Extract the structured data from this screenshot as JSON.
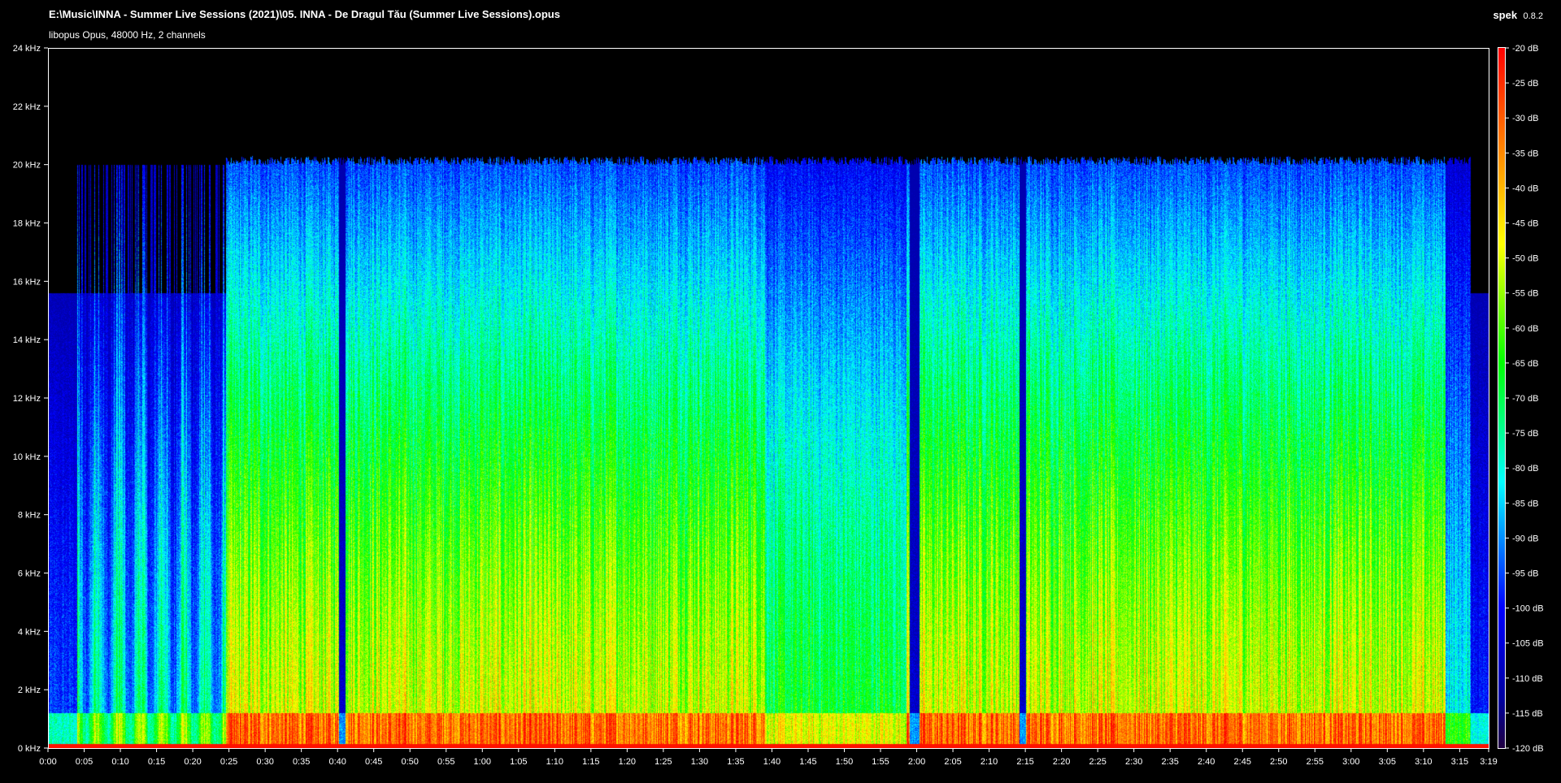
{
  "header": {
    "file_path": "E:\\Music\\INNA - Summer Live Sessions (2021)\\05. INNA - De Dragul Tău (Summer Live Sessions).opus",
    "file_info": "libopus Opus, 48000 Hz, 2 channels",
    "app_name": "spek",
    "app_version": "0.8.2"
  },
  "frequency_axis": {
    "ticks": [
      "0 kHz",
      "2 kHz",
      "4 kHz",
      "6 kHz",
      "8 kHz",
      "10 kHz",
      "12 kHz",
      "14 kHz",
      "16 kHz",
      "18 kHz",
      "20 kHz",
      "22 kHz",
      "24 kHz"
    ]
  },
  "time_axis": {
    "ticks": [
      "0:00",
      "0:05",
      "0:10",
      "0:15",
      "0:20",
      "0:25",
      "0:30",
      "0:35",
      "0:40",
      "0:45",
      "0:50",
      "0:55",
      "1:00",
      "1:05",
      "1:10",
      "1:15",
      "1:20",
      "1:25",
      "1:30",
      "1:35",
      "1:40",
      "1:45",
      "1:50",
      "1:55",
      "2:00",
      "2:05",
      "2:10",
      "2:15",
      "2:20",
      "2:25",
      "2:30",
      "2:35",
      "2:40",
      "2:45",
      "2:50",
      "2:55",
      "3:00",
      "3:05",
      "3:10",
      "3:15",
      "3:19"
    ]
  },
  "db_scale": {
    "ticks": [
      "-20 dB",
      "-25 dB",
      "-30 dB",
      "-35 dB",
      "-40 dB",
      "-45 dB",
      "-50 dB",
      "-55 dB",
      "-60 dB",
      "-65 dB",
      "-70 dB",
      "-75 dB",
      "-80 dB",
      "-85 dB",
      "-90 dB",
      "-95 dB",
      "-100 dB",
      "-105 dB",
      "-110 dB",
      "-115 dB",
      "-120 dB"
    ],
    "colors": [
      "#ff0000",
      "#ff8000",
      "#ffff00",
      "#00ff00",
      "#00ffff",
      "#0000ff",
      "#0000a0",
      "#200040"
    ]
  }
}
